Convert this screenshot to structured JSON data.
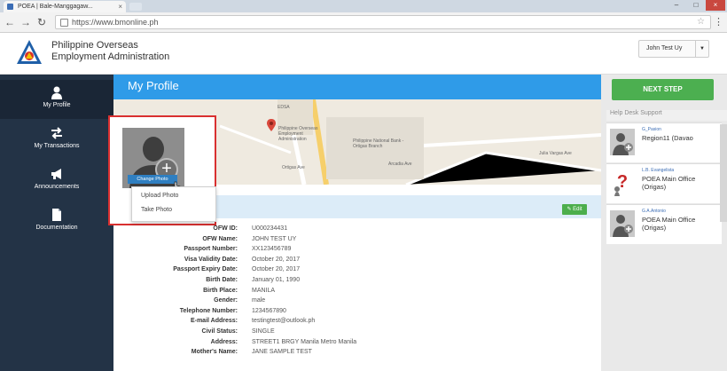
{
  "browser": {
    "tab_title": "POEA | Bale-Manggagaw...",
    "tab_close": "×",
    "url": "https://www.bmonline.ph",
    "back": "←",
    "forward": "→",
    "reload": "↻",
    "star": "☆",
    "menu": "⋮",
    "win_min": "–",
    "win_max": "□",
    "win_close": "×"
  },
  "header": {
    "org_line1": "Philippine Overseas",
    "org_line2": "Employment Administration",
    "user_name": "John Test Uy",
    "user_caret": "▼"
  },
  "sidebar": {
    "items": [
      {
        "label": "My Profile",
        "icon": "user-icon"
      },
      {
        "label": "My Transactions",
        "icon": "transactions-icon"
      },
      {
        "label": "Announcements",
        "icon": "megaphone-icon"
      },
      {
        "label": "Documentation",
        "icon": "document-icon"
      }
    ]
  },
  "main": {
    "title": "My Profile",
    "edit_label": "✎ Edit",
    "map": {
      "poea_label": "Philippine Overseas Employment Administration",
      "pnb_label": "Philippine National Bank - Ortigas Branch",
      "edsa_label": "EDSA",
      "ave_label": "Arcadia Ave",
      "ortigas_label": "Ortigas Ave",
      "julia_label": "Julia Vargas Ave"
    },
    "photo": {
      "change_label": "Change Photo",
      "plus": "+",
      "menu_upload": "Upload Photo",
      "menu_take": "Take Photo"
    },
    "fields": [
      {
        "label": "OFW ID:",
        "value": "U000234431"
      },
      {
        "label": "OFW Name:",
        "value": "JOHN TEST UY"
      },
      {
        "label": "Passport Number:",
        "value": "XX123456789"
      },
      {
        "label": "Visa Validity Date:",
        "value": "October 20, 2017"
      },
      {
        "label": "Passport Expiry Date:",
        "value": "October 20, 2017"
      },
      {
        "label": "Birth Date:",
        "value": "January 01, 1990"
      },
      {
        "label": "Birth Place:",
        "value": "MANILA"
      },
      {
        "label": "Gender:",
        "value": "male"
      },
      {
        "label": "Telephone Number:",
        "value": "1234567890"
      },
      {
        "label": "E-mail Address:",
        "value": "testingtest@outlook.ph"
      },
      {
        "label": "Civil Status:",
        "value": "SINGLE"
      },
      {
        "label": "Address:",
        "value": "STREET1 BRGY Manila Metro Manila"
      },
      {
        "label": "Mother's Name:",
        "value": "JANE SAMPLE TEST"
      }
    ]
  },
  "right": {
    "next_step": "NEXT STEP",
    "help_title": "Help Desk Support",
    "contacts": [
      {
        "name": "G_Pasion",
        "office": "Region11 (Davao",
        "question": false
      },
      {
        "name": "L.B. Evangelista",
        "office": "POEA Main Office (Origas)",
        "question": true
      },
      {
        "name": "G.A.Antonio",
        "office": "POEA Main Office (Origas)",
        "question": false
      }
    ]
  }
}
